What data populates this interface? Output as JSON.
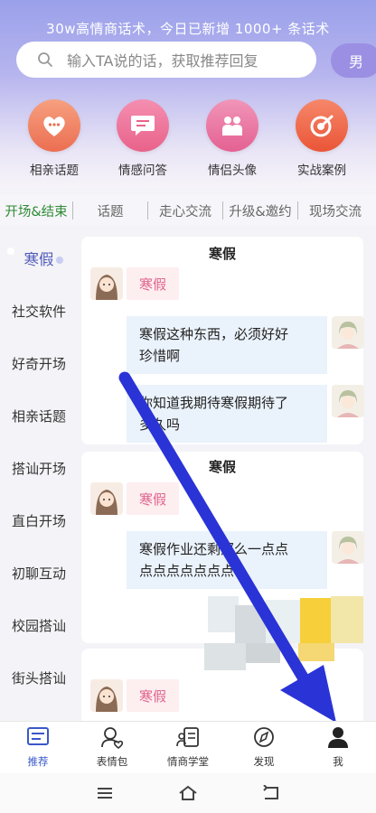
{
  "header": {
    "note": "30w高情商话术，今日已新增 1000+ 条话术",
    "search_placeholder": "输入TA说的话，获取推荐回复",
    "gender": "男"
  },
  "quick": [
    {
      "label": "相亲话题",
      "icon": "heart-chat-icon",
      "color": "#ef7b5e"
    },
    {
      "label": "情感问答",
      "icon": "chat-bubble-icon",
      "color": "#ec6a90"
    },
    {
      "label": "情侣头像",
      "icon": "couple-icon",
      "color": "#e66591"
    },
    {
      "label": "实战案例",
      "icon": "target-icon",
      "color": "#ef6747"
    }
  ],
  "tabs": [
    "开场&结束",
    "话题",
    "走心交流",
    "升级&邀约",
    "现场交流"
  ],
  "sidebar": [
    "寒假",
    "社交软件",
    "好奇开场",
    "相亲话题",
    "搭讪开场",
    "直白开场",
    "初聊互动",
    "校园搭讪",
    "街头搭讪"
  ],
  "cards": [
    {
      "title": "寒假",
      "tag": "寒假",
      "bubbles": [
        "寒假这种东西，必须好好",
        "珍惜啊",
        "你知道我期待寒假期待了",
        "多久吗"
      ]
    },
    {
      "title": "寒假",
      "tag": "寒假",
      "bubbles": [
        "寒假作业还剩那么一点点",
        "点点点点点点点"
      ]
    },
    {
      "tag": "寒假"
    }
  ],
  "nav": [
    {
      "label": "推荐",
      "icon": "recommend-icon"
    },
    {
      "label": "表情包",
      "icon": "sticker-icon"
    },
    {
      "label": "情商学堂",
      "icon": "classroom-icon"
    },
    {
      "label": "发现",
      "icon": "compass-icon"
    },
    {
      "label": "我",
      "icon": "profile-icon"
    }
  ],
  "colors": {
    "accent": "#3a58c9",
    "active_tab": "#2e8b34",
    "tag_text": "#e0648e",
    "arrow": "#2a33d6"
  }
}
